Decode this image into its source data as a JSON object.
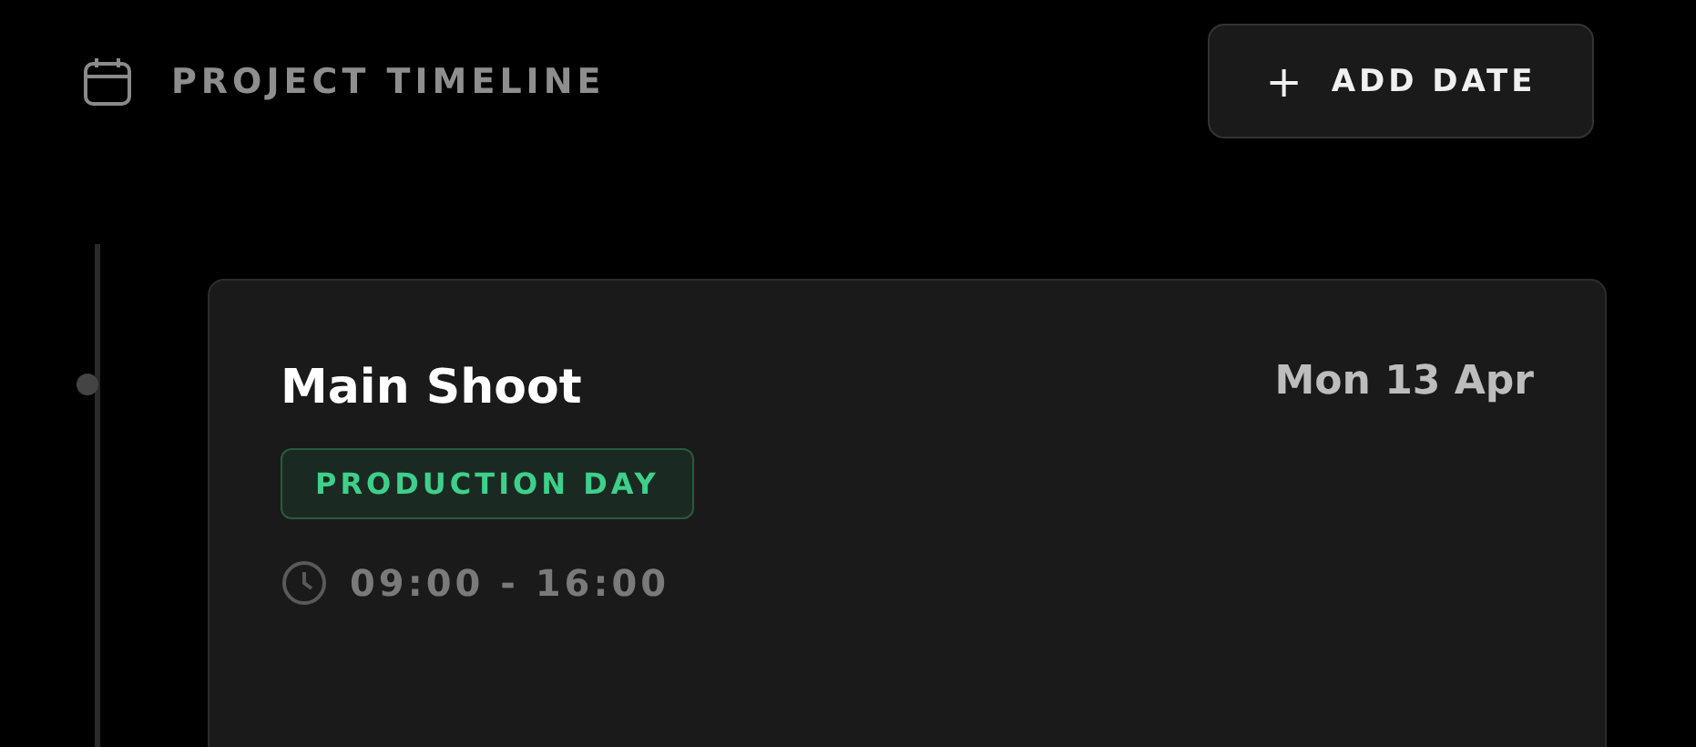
{
  "header": {
    "title": "PROJECT TIMELINE",
    "button": {
      "icon": "+",
      "label": "ADD DATE"
    }
  },
  "events": [
    {
      "title": "Main Shoot",
      "date": "Mon 13 Apr",
      "tag": "PRODUCTION DAY",
      "time": "09:00 - 16:00"
    }
  ]
}
